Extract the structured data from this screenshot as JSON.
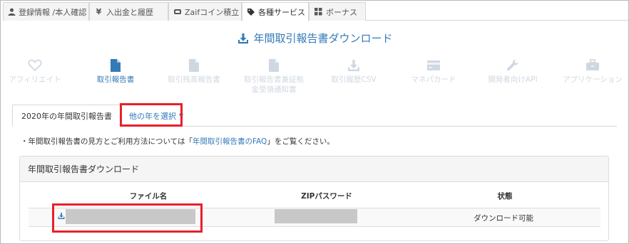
{
  "top_tabs": [
    {
      "label": "登録情報 /本人確認",
      "icon": "user-icon"
    },
    {
      "label": "入出金と履歴",
      "icon": "yen-icon"
    },
    {
      "label": "Zaifコイン積立",
      "icon": "piggy-bank-icon"
    },
    {
      "label": "各種サービス",
      "icon": "tags-icon",
      "active": true
    },
    {
      "label": "ボーナス",
      "icon": "grid-icon"
    }
  ],
  "page_title": "年間取引報告書ダウンロード",
  "services": [
    {
      "label": "アフィリエイト",
      "icon": "heart-icon"
    },
    {
      "label": "取引報告書",
      "icon": "file-icon",
      "active": true
    },
    {
      "label": "取引残高報告書",
      "icon": "file-icon"
    },
    {
      "label": "取引報告書兼証拠金受領通知書",
      "line1": "取引報告書兼証拠",
      "line2": "金受領通知書",
      "icon": "file-icon"
    },
    {
      "label": "取引履歴CSV",
      "icon": "download-icon"
    },
    {
      "label": "マネパカード",
      "icon": "credit-card-icon"
    },
    {
      "label": "開発者向けAPI",
      "icon": "wrench-icon"
    },
    {
      "label": "アプリケーション",
      "icon": "briefcase-icon"
    }
  ],
  "sub_tabs": {
    "current": "2020年の年間取引報告書",
    "other": "他の年を選択"
  },
  "note": {
    "prefix": "・年間取引報告書の見方とご利用方法については「",
    "link": "年間取引報告書のFAQ",
    "suffix": "」をご覧ください。"
  },
  "panel": {
    "title": "年間取引報告書ダウンロード",
    "columns": [
      "ファイル名",
      "ZIPパスワード",
      "状態"
    ],
    "rows": [
      {
        "status": "ダウンロード可能"
      }
    ]
  },
  "colors": {
    "accent": "#337ab7",
    "highlight": "#e8202a",
    "inactive_nav": "#cfd8e2"
  }
}
